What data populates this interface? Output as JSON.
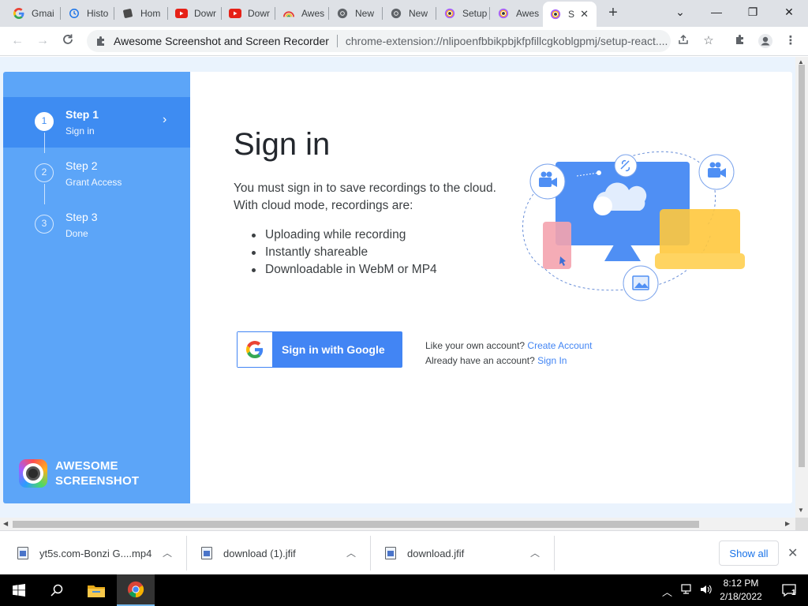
{
  "browser": {
    "tabs": [
      {
        "label": "Gmai",
        "icon": "google-icon"
      },
      {
        "label": "Histo",
        "icon": "history-icon"
      },
      {
        "label": "Hom",
        "icon": "home-favicon-icon"
      },
      {
        "label": "Dowr",
        "icon": "youtube-icon"
      },
      {
        "label": "Dowr",
        "icon": "youtube-icon"
      },
      {
        "label": "Awes",
        "icon": "rainbow-icon"
      },
      {
        "label": "New",
        "icon": "chrome-icon"
      },
      {
        "label": "New",
        "icon": "chrome-icon"
      },
      {
        "label": "Setup",
        "icon": "awesome-screenshot-icon"
      },
      {
        "label": "Awes",
        "icon": "awesome-screenshot-icon"
      },
      {
        "label": "S",
        "icon": "awesome-screenshot-icon",
        "active": true
      }
    ],
    "new_tab": "+",
    "window_controls": {
      "tab_search": "⌄",
      "minimize": "—",
      "restore": "❐",
      "close": "✕"
    },
    "omnibox": {
      "origin": "Awesome Screenshot and Screen Recorder",
      "url": "chrome-extension://nlipoenfbbikpbjkfpfillcgkoblgpmj/setup-react...."
    }
  },
  "sidebar": {
    "steps": [
      {
        "number": "1",
        "title": "Step 1",
        "subtitle": "Sign in",
        "current": true
      },
      {
        "number": "2",
        "title": "Step 2",
        "subtitle": "Grant Access"
      },
      {
        "number": "3",
        "title": "Step 3",
        "subtitle": "Done"
      }
    ],
    "brand_line1": "AWESOME",
    "brand_line2": "SCREENSHOT"
  },
  "main": {
    "heading": "Sign in",
    "intro": "You must sign in to save recordings to the cloud. With cloud mode, recordings are:",
    "bullets": [
      "Uploading while recording",
      "Instantly shareable",
      "Downloadable in WebM or MP4"
    ],
    "google_button": "Sign in with Google",
    "own_account_prompt": "Like your own account?",
    "create_account_link": "Create Account",
    "have_account_prompt": "Already have an account?",
    "sign_in_link": "Sign In"
  },
  "downloads": {
    "items": [
      "yt5s.com-Bonzi G....mp4",
      "download (1).jfif",
      "download.jfif"
    ],
    "show_all": "Show all"
  },
  "taskbar": {
    "time": "8:12 PM",
    "date": "2/18/2022",
    "notification_count": "1"
  },
  "colors": {
    "sidebar": "#5ca5f8",
    "sidebar_active": "#3e8cf2",
    "google_blue": "#4285f4",
    "link": "#4285f4"
  }
}
